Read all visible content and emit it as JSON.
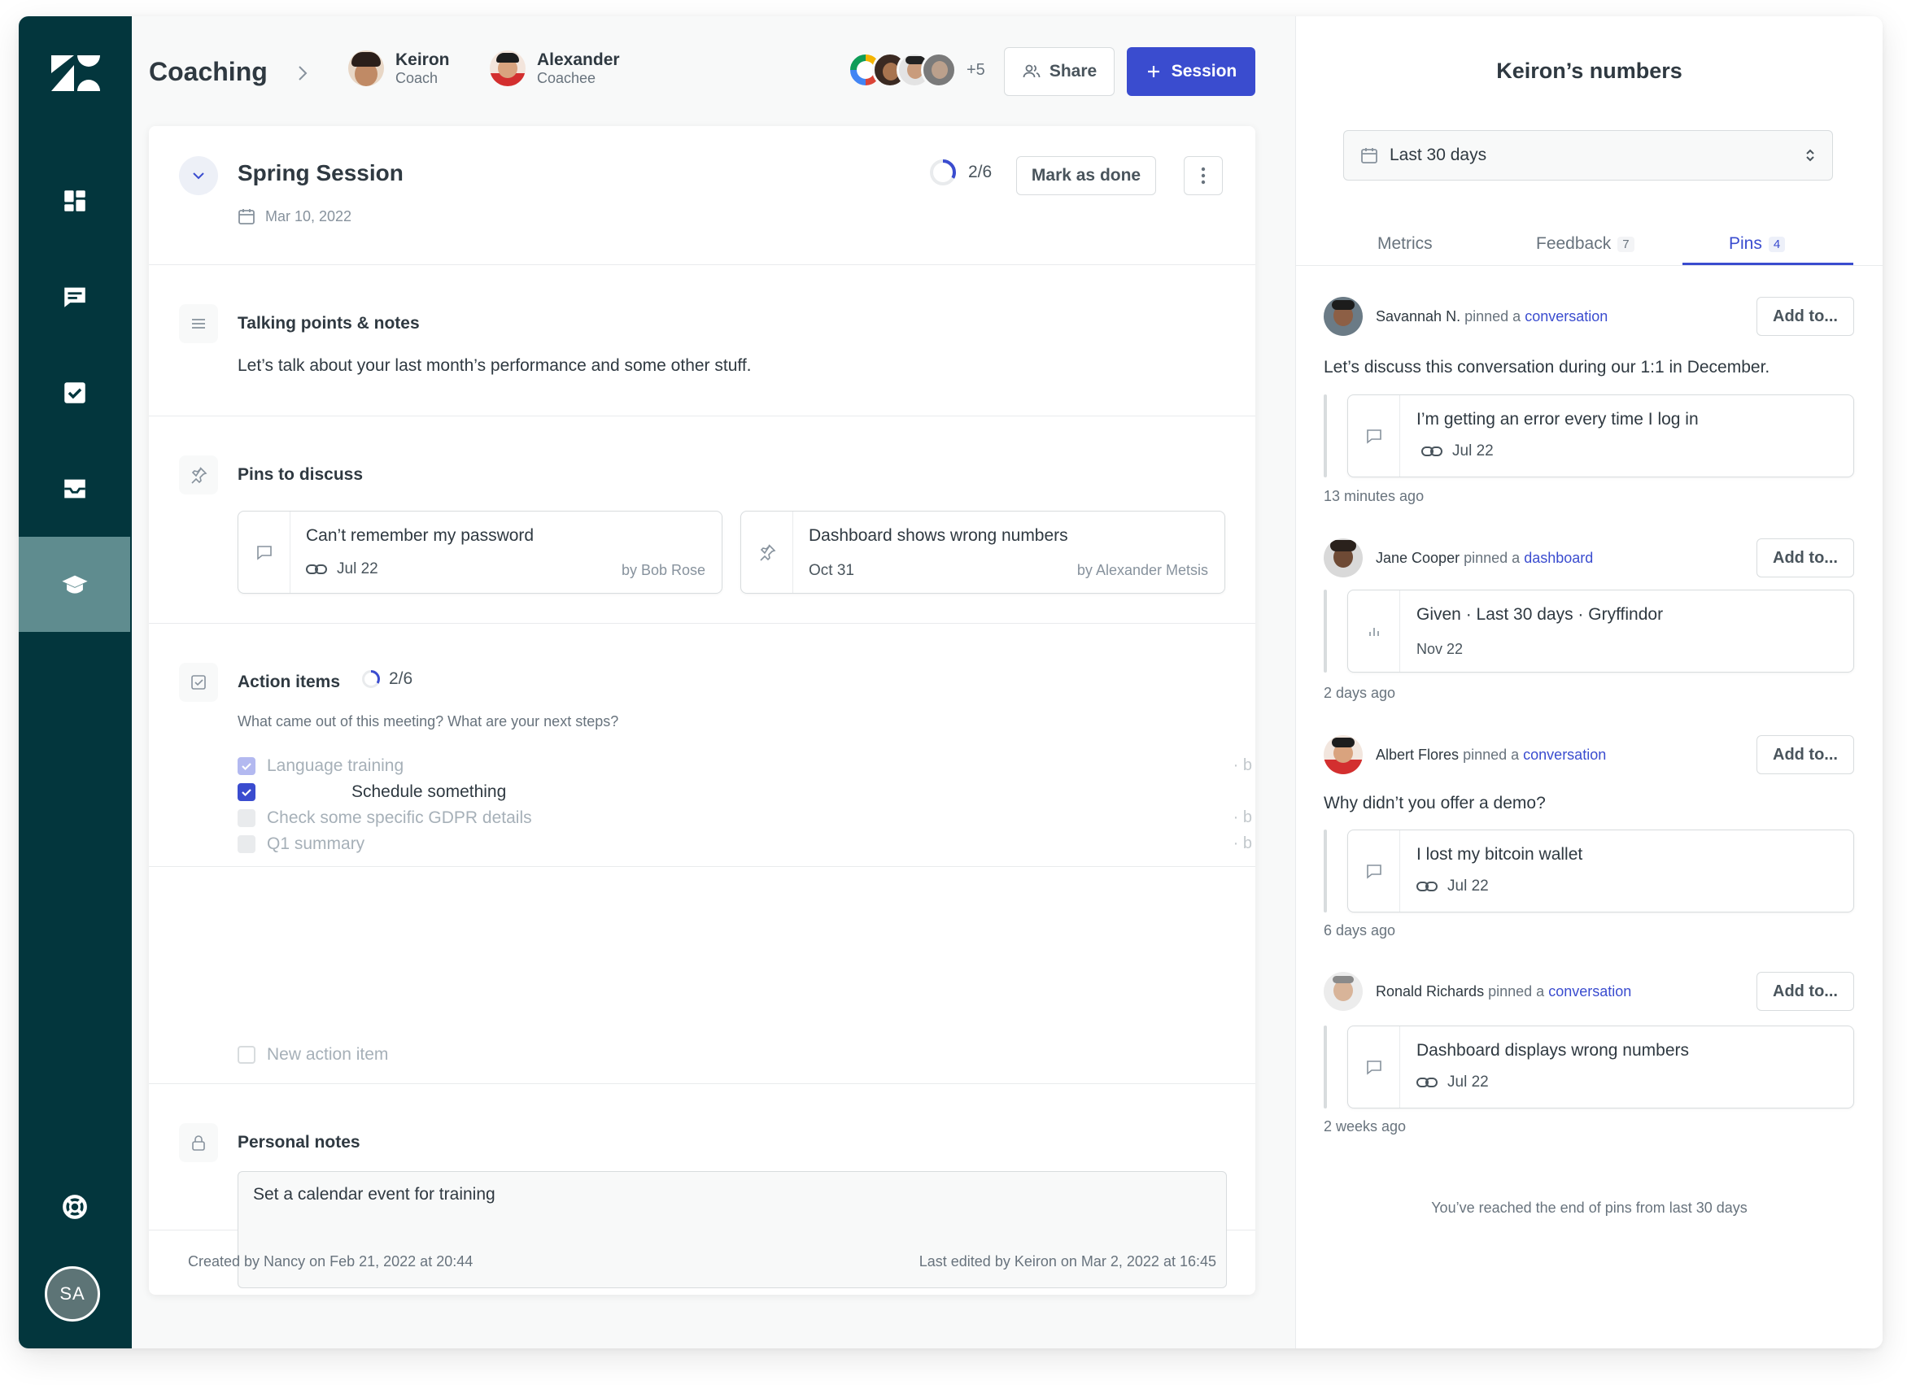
{
  "header": {
    "title": "Coaching",
    "coach": {
      "name": "Keiron",
      "role": "Coach"
    },
    "coachee": {
      "name": "Alexander",
      "role": "Coachee"
    },
    "participants_more": "+5",
    "share_label": "Share",
    "session_button_label": "Session"
  },
  "sidebar": {
    "items": [
      "dashboard-icon",
      "chat-icon",
      "tasks-icon",
      "inbox-icon",
      "coaching-icon"
    ],
    "active_item": "coaching-icon",
    "user_initials": "SA"
  },
  "session": {
    "title": "Spring Session",
    "date": "Mar 10, 2022",
    "progress": "2/6",
    "progress_fraction": 0.33,
    "mark_done_label": "Mark as done"
  },
  "talking_points": {
    "title": "Talking points & notes",
    "body": "Let’s talk about your last month’s performance and some other stuff."
  },
  "pins_to_discuss": {
    "title": "Pins to discuss",
    "items": [
      {
        "title": "Can’t remember my password",
        "meta": "Jul 22",
        "by": "by Bob Rose",
        "icon": "chat-icon"
      },
      {
        "title": "Dashboard shows wrong numbers",
        "meta": "Oct 31",
        "by": "by Alexander Metsis",
        "icon": "pin-icon"
      }
    ]
  },
  "action_items": {
    "title": "Action items",
    "progress": "2/6",
    "subtitle": "What came out of this meeting? What are your next steps?",
    "items": [
      {
        "label": "Language training",
        "state": "checked-faded",
        "tail": "· b"
      },
      {
        "label": "Schedule something",
        "state": "checked",
        "tail": ""
      },
      {
        "label": "Check some specific GDPR details",
        "state": "disabled",
        "tail": "· b"
      },
      {
        "label": "Q1 summary",
        "state": "disabled",
        "tail": "· b"
      },
      {
        "label": "New action item",
        "state": "empty",
        "tail": ""
      }
    ]
  },
  "personal_notes": {
    "title": "Personal notes",
    "value": "Set a calendar event for training"
  },
  "footer": {
    "created": "Created by Nancy on Feb 21, 2022 at 20:44",
    "edited": "Last edited by Keiron on Mar 2, 2022 at 16:45"
  },
  "panel": {
    "title": "Keiron’s numbers",
    "range": "Last 30 days",
    "tabs": [
      {
        "label": "Metrics",
        "count": ""
      },
      {
        "label": "Feedback",
        "count": "7"
      },
      {
        "label": "Pins",
        "count": "4"
      }
    ],
    "active_tab": "Pins",
    "add_to_label": "Add to...",
    "pins": [
      {
        "user": "Savannah N.",
        "verb": "pinned a",
        "object": "conversation",
        "comment": "Let’s discuss this conversation during our 1:1 in December.",
        "quote_title": "I’m getting an error every time I log in",
        "quote_meta": "Jul 22",
        "ago": "13 minutes ago"
      },
      {
        "user": "Jane Cooper",
        "verb": "pinned a",
        "object": "dashboard",
        "comment": "",
        "quote_title": "Given · Last 30 days · Gryffindor",
        "quote_meta": "Nov 22",
        "ago": "2 days ago"
      },
      {
        "user": "Albert Flores",
        "verb": "pinned a",
        "object": "conversation",
        "comment": "Why didn’t you offer a demo?",
        "quote_title": "I lost my bitcoin wallet",
        "quote_meta": "Jul 22",
        "ago": "6 days ago"
      },
      {
        "user": "Ronald Richards",
        "verb": "pinned a",
        "object": "conversation",
        "comment": "",
        "quote_title": "Dashboard displays wrong numbers",
        "quote_meta": "Jul 22",
        "ago": "2 weeks ago"
      }
    ],
    "end_note": "You’ve reached the end of pins from last 30 days"
  },
  "colors": {
    "sidebar": "#03363d",
    "sidebar_active": "#5f8c8f",
    "accent": "#3a4ccf",
    "text": "#2f3941",
    "muted": "#68737d"
  }
}
